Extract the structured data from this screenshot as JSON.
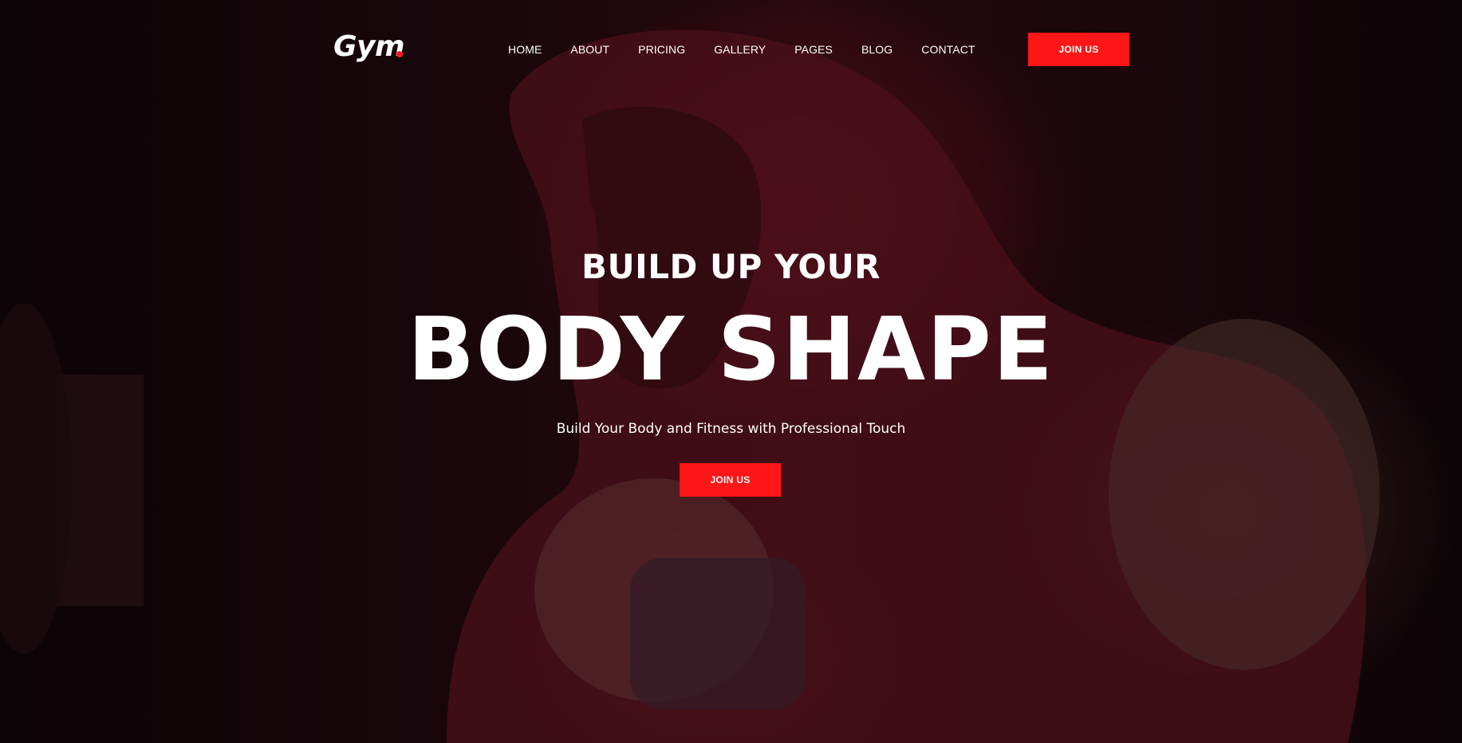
{
  "navbar": {
    "logo_text": "Gym",
    "menu": [
      {
        "label": "HOME"
      },
      {
        "label": "ABOUT"
      },
      {
        "label": "PRICING"
      },
      {
        "label": "GALLERY"
      },
      {
        "label": "PAGES"
      },
      {
        "label": "BLOG"
      },
      {
        "label": "CONTACT"
      }
    ],
    "join_label": "JOIN US"
  },
  "hero": {
    "subtitle": "BUILD UP YOUR",
    "title": "BODY SHAPE",
    "tagline": "Build Your Body and Fitness with Professional Touch",
    "join_label": "JOIN US"
  },
  "colors": {
    "accent": "#ff1616",
    "text": "#ffffff",
    "background": "#1a070c"
  }
}
